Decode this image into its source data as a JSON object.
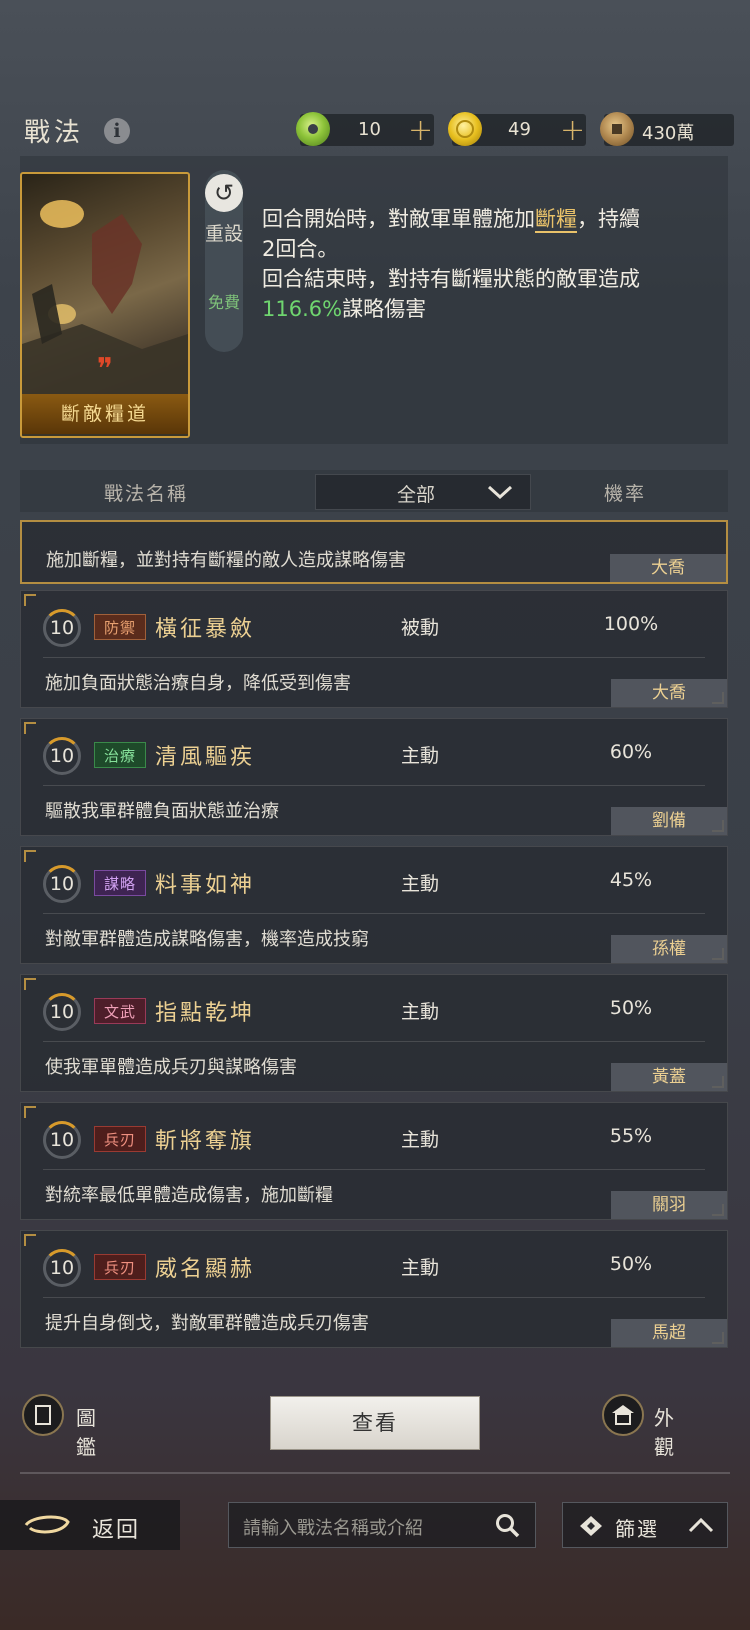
{
  "header": {
    "title": "戰法",
    "resources": [
      {
        "icon": "jade-icon",
        "value": "10",
        "has_plus": true
      },
      {
        "icon": "gold-coin-icon",
        "value": "49",
        "has_plus": true
      },
      {
        "icon": "copper-coin-icon",
        "value": "430萬",
        "has_plus": false
      }
    ]
  },
  "detail": {
    "card_name": "斷敵糧道",
    "reset_label": "重設",
    "free_label": "免費",
    "desc_l1_a": "回合開始時，對敵軍單體施加",
    "desc_l1_hl": "斷糧",
    "desc_l1_b": "，持續",
    "desc_l2": "2回合。",
    "desc_l3": "回合結束時，對持有斷糧狀態的敵軍造成",
    "desc_l4_pct": "116.6%",
    "desc_l4_b": "謀略傷害"
  },
  "list_header": {
    "name_col": "戰法名稱",
    "filter_value": "全部",
    "rate_col": "機率"
  },
  "partial_row": {
    "desc": "施加斷糧，並對持有斷糧的敵人造成謀略傷害",
    "hero": "大喬"
  },
  "rows": [
    {
      "level": "10",
      "tag": "防禦",
      "name": "橫征暴斂",
      "type": "被動",
      "rate": "100%",
      "desc": "施加負面狀態治療自身，降低受到傷害",
      "hero": "大喬"
    },
    {
      "level": "10",
      "tag": "治療",
      "name": "清風驅疾",
      "type": "主動",
      "rate": "60%",
      "desc": "驅散我軍群體負面狀態並治療",
      "hero": "劉備"
    },
    {
      "level": "10",
      "tag": "謀略",
      "name": "料事如神",
      "type": "主動",
      "rate": "45%",
      "desc": "對敵軍群體造成謀略傷害，機率造成技窮",
      "hero": "孫權"
    },
    {
      "level": "10",
      "tag": "文武",
      "name": "指點乾坤",
      "type": "主動",
      "rate": "50%",
      "desc": "使我軍單體造成兵刃與謀略傷害",
      "hero": "黃蓋"
    },
    {
      "level": "10",
      "tag": "兵刃",
      "name": "斬將奪旗",
      "type": "主動",
      "rate": "55%",
      "desc": "對統率最低單體造成傷害，施加斷糧",
      "hero": "關羽"
    },
    {
      "level": "10",
      "tag": "兵刃",
      "name": "威名顯赫",
      "type": "主動",
      "rate": "50%",
      "desc": "提升自身倒戈，對敵軍群體造成兵刃傷害",
      "hero": "馬超"
    }
  ],
  "bottom": {
    "atlas_label": "圖鑑",
    "view_label": "查看",
    "appearance_label": "外觀",
    "back_label": "返回",
    "search_placeholder": "請輸入戰法名稱或介紹",
    "filter_label": "篩選"
  },
  "colors": {
    "accent_gold": "#c99a3a",
    "highlight": "#e9c26a",
    "green": "#6fd56f"
  }
}
